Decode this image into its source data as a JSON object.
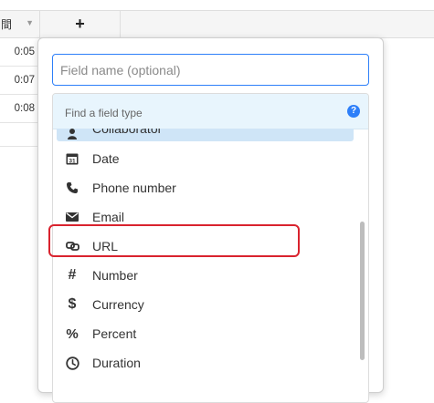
{
  "grid": {
    "column_header": "間",
    "add_column_label": "+",
    "rows": [
      "0:05",
      "0:07",
      "0:08"
    ]
  },
  "popup": {
    "field_name_placeholder": "Field name (optional)",
    "type_search_placeholder": "Find a field type",
    "help_label": "?",
    "field_types": [
      {
        "label": "Collaborator",
        "icon": "person-icon"
      },
      {
        "label": "Date",
        "icon": "calendar-icon"
      },
      {
        "label": "Phone number",
        "icon": "phone-icon"
      },
      {
        "label": "Email",
        "icon": "envelope-icon"
      },
      {
        "label": "URL",
        "icon": "link-icon"
      },
      {
        "label": "Number",
        "icon": "hash-icon"
      },
      {
        "label": "Currency",
        "icon": "dollar-icon"
      },
      {
        "label": "Percent",
        "icon": "percent-icon"
      },
      {
        "label": "Duration",
        "icon": "clock-icon"
      }
    ],
    "highlighted_type": "URL"
  },
  "colors": {
    "accent": "#2d7ff9",
    "search_bg": "#e8f5fd",
    "highlight_border": "#d9232e"
  }
}
